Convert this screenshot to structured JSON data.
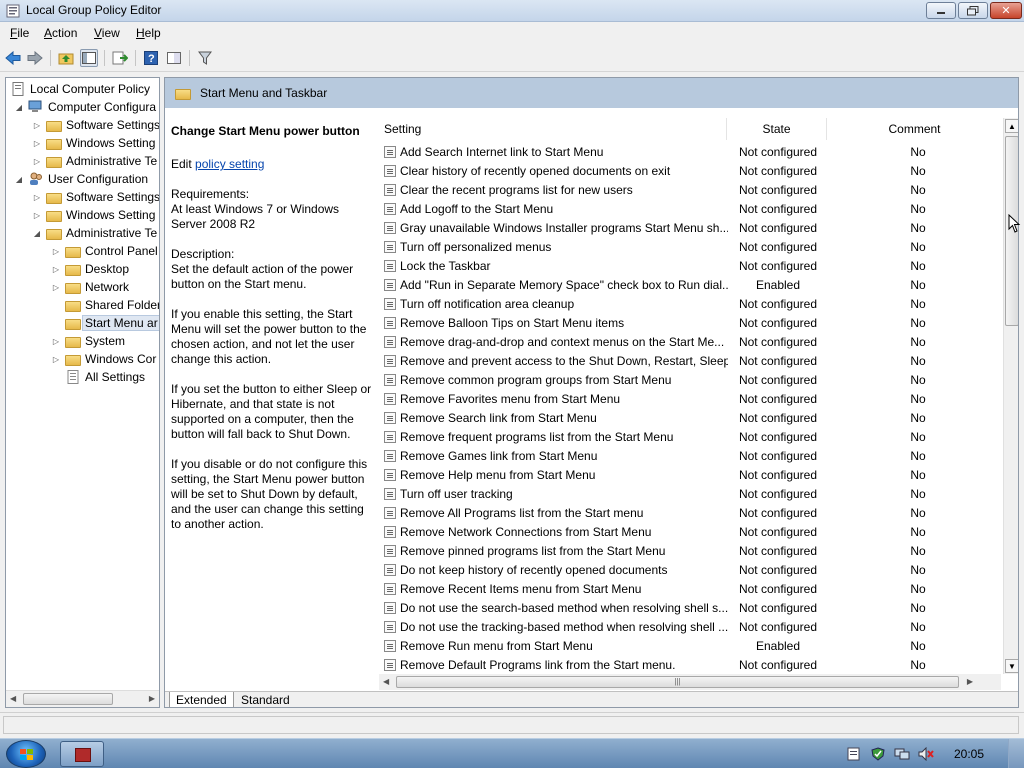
{
  "window": {
    "title": "Local Group Policy Editor"
  },
  "menu": [
    {
      "label_u": "F",
      "label_rest": "ile"
    },
    {
      "label_u": "A",
      "label_rest": "ction"
    },
    {
      "label_u": "V",
      "label_rest": "iew"
    },
    {
      "label_u": "H",
      "label_rest": "elp"
    }
  ],
  "tree": {
    "root": "Local Computer Policy",
    "computer_config": "Computer Configura",
    "cc_software": "Software Settings",
    "cc_windows": "Windows Setting",
    "cc_admin": "Administrative Te",
    "user_config": "User Configuration",
    "uc_software": "Software Settings",
    "uc_windows": "Windows Setting",
    "uc_admin": "Administrative Te",
    "control_panel": "Control Panel",
    "desktop": "Desktop",
    "network": "Network",
    "shared_folders": "Shared Folder",
    "start_menu": "Start Menu ar",
    "system": "System",
    "windows_components": "Windows Cor",
    "all_settings": "All Settings"
  },
  "panel": {
    "header_title": "Start Menu and Taskbar",
    "description": {
      "title": "Change Start Menu power button",
      "edit_prefix": "Edit ",
      "edit_link": "policy setting",
      "requirements": "Requirements:\nAt least Windows 7 or Windows Server 2008 R2",
      "description": "Description:\nSet the default action of the power button on the Start menu.",
      "para1": "If you enable this setting, the Start Menu will set the power button to the chosen action, and not let the user change this action.",
      "para2": "If you set the button to either Sleep or Hibernate, and that state is not supported on a computer, then the button will fall back to Shut Down.",
      "para3": "If you disable or do not configure this setting, the Start Menu power button will be set to Shut Down by default, and the user can change this setting to another action."
    },
    "columns": {
      "setting": "Setting",
      "state": "State",
      "comment": "Comment"
    },
    "rows": [
      {
        "name": "Add Search Internet link to Start Menu",
        "state": "Not configured",
        "comment": "No"
      },
      {
        "name": "Clear history of recently opened documents on exit",
        "state": "Not configured",
        "comment": "No"
      },
      {
        "name": "Clear the recent programs list for new users",
        "state": "Not configured",
        "comment": "No"
      },
      {
        "name": "Add Logoff to the Start Menu",
        "state": "Not configured",
        "comment": "No"
      },
      {
        "name": "Gray unavailable Windows Installer programs Start Menu sh...",
        "state": "Not configured",
        "comment": "No"
      },
      {
        "name": "Turn off personalized menus",
        "state": "Not configured",
        "comment": "No"
      },
      {
        "name": "Lock the Taskbar",
        "state": "Not configured",
        "comment": "No"
      },
      {
        "name": "Add \"Run in Separate Memory Space\" check box to Run dial...",
        "state": "Enabled",
        "comment": "No"
      },
      {
        "name": "Turn off notification area cleanup",
        "state": "Not configured",
        "comment": "No"
      },
      {
        "name": "Remove Balloon Tips on Start Menu items",
        "state": "Not configured",
        "comment": "No"
      },
      {
        "name": "Remove drag-and-drop and context menus on the Start Me...",
        "state": "Not configured",
        "comment": "No"
      },
      {
        "name": "Remove and prevent access to the Shut Down, Restart, Sleep...",
        "state": "Not configured",
        "comment": "No"
      },
      {
        "name": "Remove common program groups from Start Menu",
        "state": "Not configured",
        "comment": "No"
      },
      {
        "name": "Remove Favorites menu from Start Menu",
        "state": "Not configured",
        "comment": "No"
      },
      {
        "name": "Remove Search link from Start Menu",
        "state": "Not configured",
        "comment": "No"
      },
      {
        "name": "Remove frequent programs list from the Start Menu",
        "state": "Not configured",
        "comment": "No"
      },
      {
        "name": "Remove Games link from Start Menu",
        "state": "Not configured",
        "comment": "No"
      },
      {
        "name": "Remove Help menu from Start Menu",
        "state": "Not configured",
        "comment": "No"
      },
      {
        "name": "Turn off user tracking",
        "state": "Not configured",
        "comment": "No"
      },
      {
        "name": "Remove All Programs list from the Start menu",
        "state": "Not configured",
        "comment": "No"
      },
      {
        "name": "Remove Network Connections from Start Menu",
        "state": "Not configured",
        "comment": "No"
      },
      {
        "name": "Remove pinned programs list from the Start Menu",
        "state": "Not configured",
        "comment": "No"
      },
      {
        "name": "Do not keep history of recently opened documents",
        "state": "Not configured",
        "comment": "No"
      },
      {
        "name": "Remove Recent Items menu from Start Menu",
        "state": "Not configured",
        "comment": "No"
      },
      {
        "name": "Do not use the search-based method when resolving shell s...",
        "state": "Not configured",
        "comment": "No"
      },
      {
        "name": "Do not use the tracking-based method when resolving shell ...",
        "state": "Not configured",
        "comment": "No"
      },
      {
        "name": "Remove Run menu from Start Menu",
        "state": "Enabled",
        "comment": "No"
      },
      {
        "name": "Remove Default Programs link from the Start menu.",
        "state": "Not configured",
        "comment": "No"
      }
    ],
    "tabs": {
      "extended": "Extended",
      "standard": "Standard"
    }
  },
  "taskbar": {
    "clock": "20:05"
  }
}
